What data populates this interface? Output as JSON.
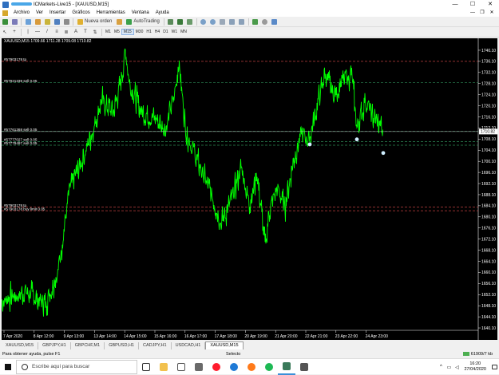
{
  "window": {
    "title": "ICMarkets-Live15 - [XAUUSD,M15]",
    "controls": [
      "—",
      "☐",
      "✕"
    ],
    "mdi_controls": [
      "—",
      "❐",
      "✕"
    ]
  },
  "menu": [
    "Archivo",
    "Ver",
    "Insertar",
    "Gráficos",
    "Herramientas",
    "Ventana",
    "Ayuda"
  ],
  "toolbar": {
    "new_order": "Nueva orden",
    "autotrading": "AutoTrading"
  },
  "timeframes": [
    "M1",
    "M5",
    "M15",
    "M30",
    "H1",
    "H4",
    "D1",
    "W1",
    "MN"
  ],
  "active_timeframe": "M15",
  "chart": {
    "info": "XAUUSD,M15  1709.66 1711.28 1709.08 1710.82",
    "current_price": "1710.82",
    "colors": {
      "background": "#000000",
      "bars": "#00ff00",
      "price_line": "#ffffff"
    },
    "price_labels": [
      "1740.10",
      "1736.10",
      "1732.10",
      "1728.10",
      "1724.10",
      "1720.10",
      "1716.10",
      "1712.10",
      "1708.10",
      "1704.10",
      "1700.10",
      "1696.10",
      "1692.10",
      "1688.10",
      "1684.10",
      "1680.10",
      "1676.10",
      "1672.10",
      "1668.10",
      "1664.10",
      "1660.10",
      "1656.10",
      "1652.10",
      "1648.10",
      "1644.10",
      "1640.10"
    ],
    "time_labels": [
      "7 Apr 2020",
      "8 Apr 12:00",
      "9 Apr 13:00",
      "13 Apr 14:00",
      "14 Apr 15:00",
      "15 Apr 16:00",
      "16 Apr 17:00",
      "17 Apr 18:00",
      "20 Apr 19:00",
      "21 Apr 20:00",
      "22 Apr 21:00",
      "23 Apr 22:00",
      "24 Apr 23:00"
    ],
    "order_lines": [
      {
        "label": "#57903178 tp",
        "price": 1736.1,
        "color": "#c04040"
      },
      {
        "label": "#57921339 sell 0.05",
        "price": 1728.4,
        "color": "#2e8b57"
      },
      {
        "label": "#57761368 sell 0.05",
        "price": 1710.9,
        "color": "#2e8b57"
      },
      {
        "label": "#57777027 sell 0.05",
        "price": 1707.2,
        "color": "#2e8b57"
      },
      {
        "label": "#57779497 sell 0.05",
        "price": 1705.9,
        "color": "#2e8b57"
      },
      {
        "label": "#57903178 tp",
        "price": 1683.6,
        "color": "#c04040"
      },
      {
        "label": "#57903178 buy limit 0.05",
        "price": 1682.3,
        "color": "#c04040"
      }
    ]
  },
  "tabs": [
    "XAUUSD,M15",
    "GBPJPY,H1",
    "GBPCHF,M1",
    "GBPUSD,H1",
    "CADJPY,H1",
    "USDCAD,H1",
    "XAUUSD,M15"
  ],
  "active_tab_index": 6,
  "status": {
    "help": "Para obtener ayuda, pulse F1",
    "profile": "Selecto",
    "traffic": "61909/7 kb"
  },
  "taskbar": {
    "search_placeholder": "Escribe aquí para buscar",
    "time": "16:20",
    "date": "27/04/2020"
  }
}
